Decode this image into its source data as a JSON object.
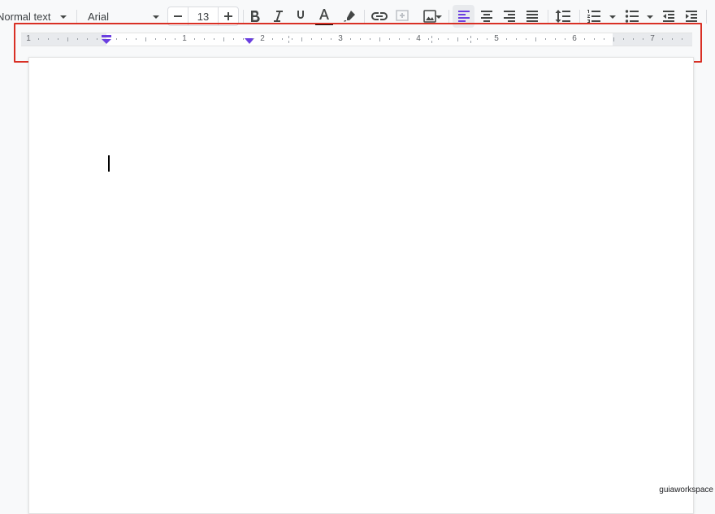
{
  "toolbar": {
    "paragraph_style": "Normal text",
    "font_name": "Arial",
    "font_size": "13",
    "icons": [
      "minus-icon",
      "plus-icon",
      "bold-icon",
      "italic-icon",
      "underline-icon",
      "text-color-icon",
      "highlight-icon",
      "link-icon",
      "comment-icon",
      "image-icon",
      "align-left-icon",
      "align-center-icon",
      "align-right-icon",
      "justify-icon",
      "line-spacing-icon",
      "numbered-list-icon",
      "bulleted-list-icon",
      "decrease-indent-icon",
      "increase-indent-icon"
    ],
    "text_color": "#000000",
    "accent_color": "#6b3fe0"
  },
  "ruler": {
    "labels": [
      "1",
      "1",
      "2",
      "3",
      "4",
      "5",
      "6",
      "7"
    ]
  },
  "watermark": "guiaworkspace"
}
